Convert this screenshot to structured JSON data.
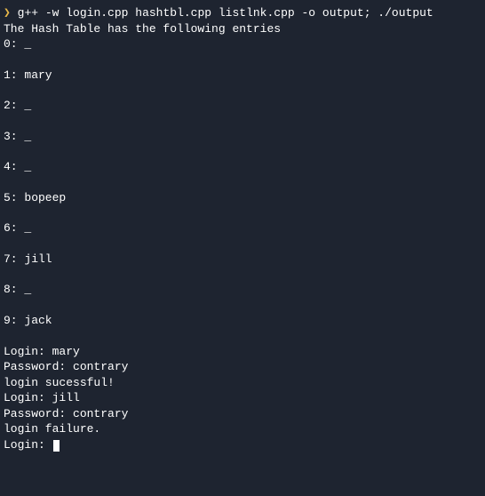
{
  "prompt_symbol": "❯",
  "command": "g++ -w login.cpp hashtbl.cpp listlnk.cpp -o output; ./output",
  "header": "The Hash Table has the following entries",
  "entries": [
    {
      "index": "0",
      "value": "_"
    },
    {
      "index": "1",
      "value": "mary"
    },
    {
      "index": "2",
      "value": "_"
    },
    {
      "index": "3",
      "value": "_"
    },
    {
      "index": "4",
      "value": "_"
    },
    {
      "index": "5",
      "value": "bopeep"
    },
    {
      "index": "6",
      "value": "_"
    },
    {
      "index": "7",
      "value": "jill"
    },
    {
      "index": "8",
      "value": "_"
    },
    {
      "index": "9",
      "value": "jack"
    }
  ],
  "session": [
    "Login: mary",
    "Password: contrary",
    "login sucessful!",
    "Login: jill",
    "Password: contrary",
    "login failure."
  ],
  "current_prompt": "Login: "
}
